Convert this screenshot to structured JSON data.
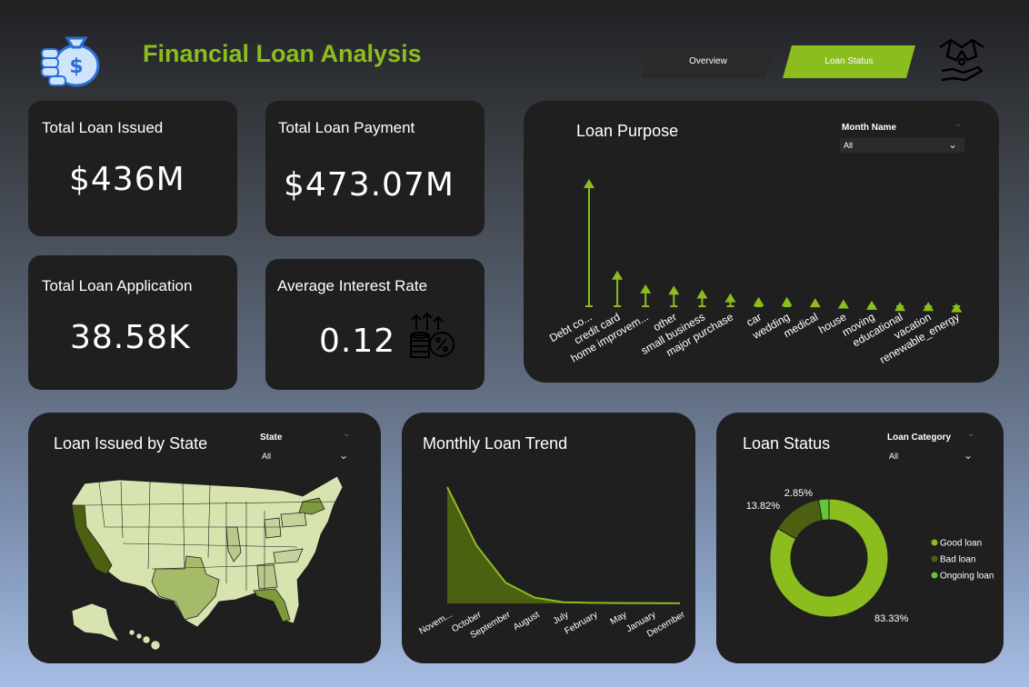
{
  "header": {
    "title": "Financial Loan Analysis",
    "logo_icon": "money-bag-icon",
    "tabs": [
      {
        "label": "Overview",
        "active": false
      },
      {
        "label": "Loan Status",
        "active": true
      }
    ],
    "handshake_icon": "handshake-icon"
  },
  "colors": {
    "accent": "#8cbd1e",
    "dark_green": "#4b6111",
    "card": "#1f1f1f"
  },
  "kpis": {
    "total_loan_issued": {
      "title": "Total Loan Issued",
      "value": "$436M"
    },
    "total_loan_payment": {
      "title": "Total Loan Payment",
      "value": "$473.07M"
    },
    "total_loan_application": {
      "title": "Total Loan Application",
      "value": "38.58K"
    },
    "average_interest_rate": {
      "title": "Average Interest Rate",
      "value": "0.12",
      "icon": "interest-growth-icon"
    }
  },
  "loan_purpose": {
    "title": "Loan Purpose",
    "slicer": {
      "label": "Month Name",
      "value": "All"
    }
  },
  "loan_by_state": {
    "title": "Loan Issued by State",
    "slicer": {
      "label": "State",
      "value": "All"
    }
  },
  "monthly_trend": {
    "title": "Monthly Loan Trend"
  },
  "loan_status": {
    "title": "Loan Status",
    "slicer": {
      "label": "Loan Category",
      "value": "All"
    }
  },
  "chart_data": [
    {
      "type": "bar",
      "chart": "loan-purpose-lollipop",
      "categories": [
        "Debt co...",
        "credit card",
        "home improvem...",
        "other",
        "small business",
        "major purchase",
        "car",
        "wedding",
        "medical",
        "house",
        "moving",
        "educational",
        "vacation",
        "renewable_energy"
      ],
      "values": [
        100,
        27,
        16,
        15,
        12,
        9,
        6,
        6,
        5,
        4,
        3,
        2,
        2,
        1
      ]
    },
    {
      "type": "area",
      "chart": "monthly-loan-trend",
      "categories": [
        "Novem...",
        "October",
        "September",
        "August",
        "July",
        "February",
        "May",
        "January",
        "December"
      ],
      "values": [
        100,
        50,
        18,
        5,
        1,
        0.5,
        0.3,
        0.2,
        0.1
      ]
    },
    {
      "type": "pie",
      "chart": "loan-status-donut",
      "labels": [
        "Good loan",
        "Bad loan",
        "Ongoing loan"
      ],
      "values": [
        83.33,
        13.82,
        2.85
      ],
      "value_labels": [
        "83.33%",
        "13.82%",
        "2.85%"
      ],
      "colors": [
        "#8cbd1e",
        "#4b6111",
        "#62c53a"
      ]
    }
  ]
}
